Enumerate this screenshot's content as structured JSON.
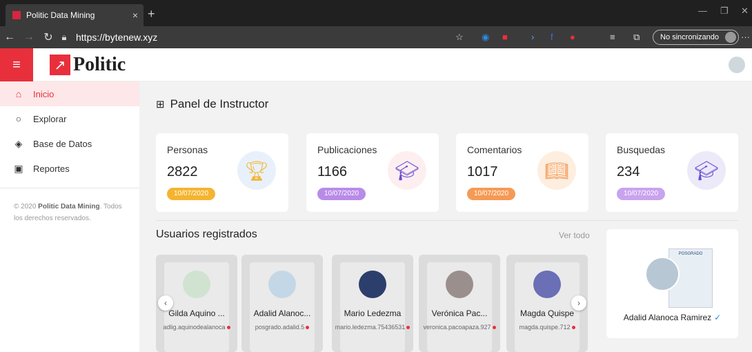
{
  "browser": {
    "tab_title": "Politic Data Mining",
    "url": "https://bytenew.xyz",
    "sync_label": "No sincronizando"
  },
  "app": {
    "logo_text": "Politic",
    "accent": "#e8303c"
  },
  "sidebar": {
    "items": [
      {
        "label": "Inicio",
        "icon": "home-icon",
        "active": true
      },
      {
        "label": "Explorar",
        "icon": "search-icon",
        "active": false
      },
      {
        "label": "Base de Datos",
        "icon": "layers-icon",
        "active": false
      },
      {
        "label": "Reportes",
        "icon": "clipboard-icon",
        "active": false
      }
    ],
    "copyright_prefix": "© 2020 ",
    "copyright_brand": "Politic Data Mining",
    "copyright_suffix": ". Todos los derechos reservados."
  },
  "main": {
    "panel_title": "Panel de Instructor",
    "stats": [
      {
        "label": "Personas",
        "value": "2822",
        "date": "10/07/2020",
        "badge_color": "#f5b430",
        "icon": "trophy-icon"
      },
      {
        "label": "Publicaciones",
        "value": "1166",
        "date": "10/07/2020",
        "badge_color": "#b98be8",
        "icon": "laptop-graduation-icon"
      },
      {
        "label": "Comentarios",
        "value": "1017",
        "date": "10/07/2020",
        "badge_color": "#f59a55",
        "icon": "book-icon"
      },
      {
        "label": "Busquedas",
        "value": "234",
        "date": "10/07/2020",
        "badge_color": "#c9a3ee",
        "icon": "graduation-network-icon"
      }
    ],
    "users_title": "Usuarios registrados",
    "view_all": "Ver todo",
    "users": [
      {
        "name": "Gilda Aquino ...",
        "handle": "adlig.aquinodealanoca"
      },
      {
        "name": "Adalid Alanoc...",
        "handle": "posgrado.adalid.5"
      },
      {
        "name": "Mario Ledezma",
        "handle": "mario.ledezma.75436531"
      },
      {
        "name": "Verónica Pac...",
        "handle": "veronica.pacoapaza.927"
      },
      {
        "name": "Magda Quispe",
        "handle": "magda.quispe.712"
      }
    ],
    "featured": {
      "name": "Adalid Alanoca Ramirez",
      "poster_text": "POSGRADO"
    }
  }
}
